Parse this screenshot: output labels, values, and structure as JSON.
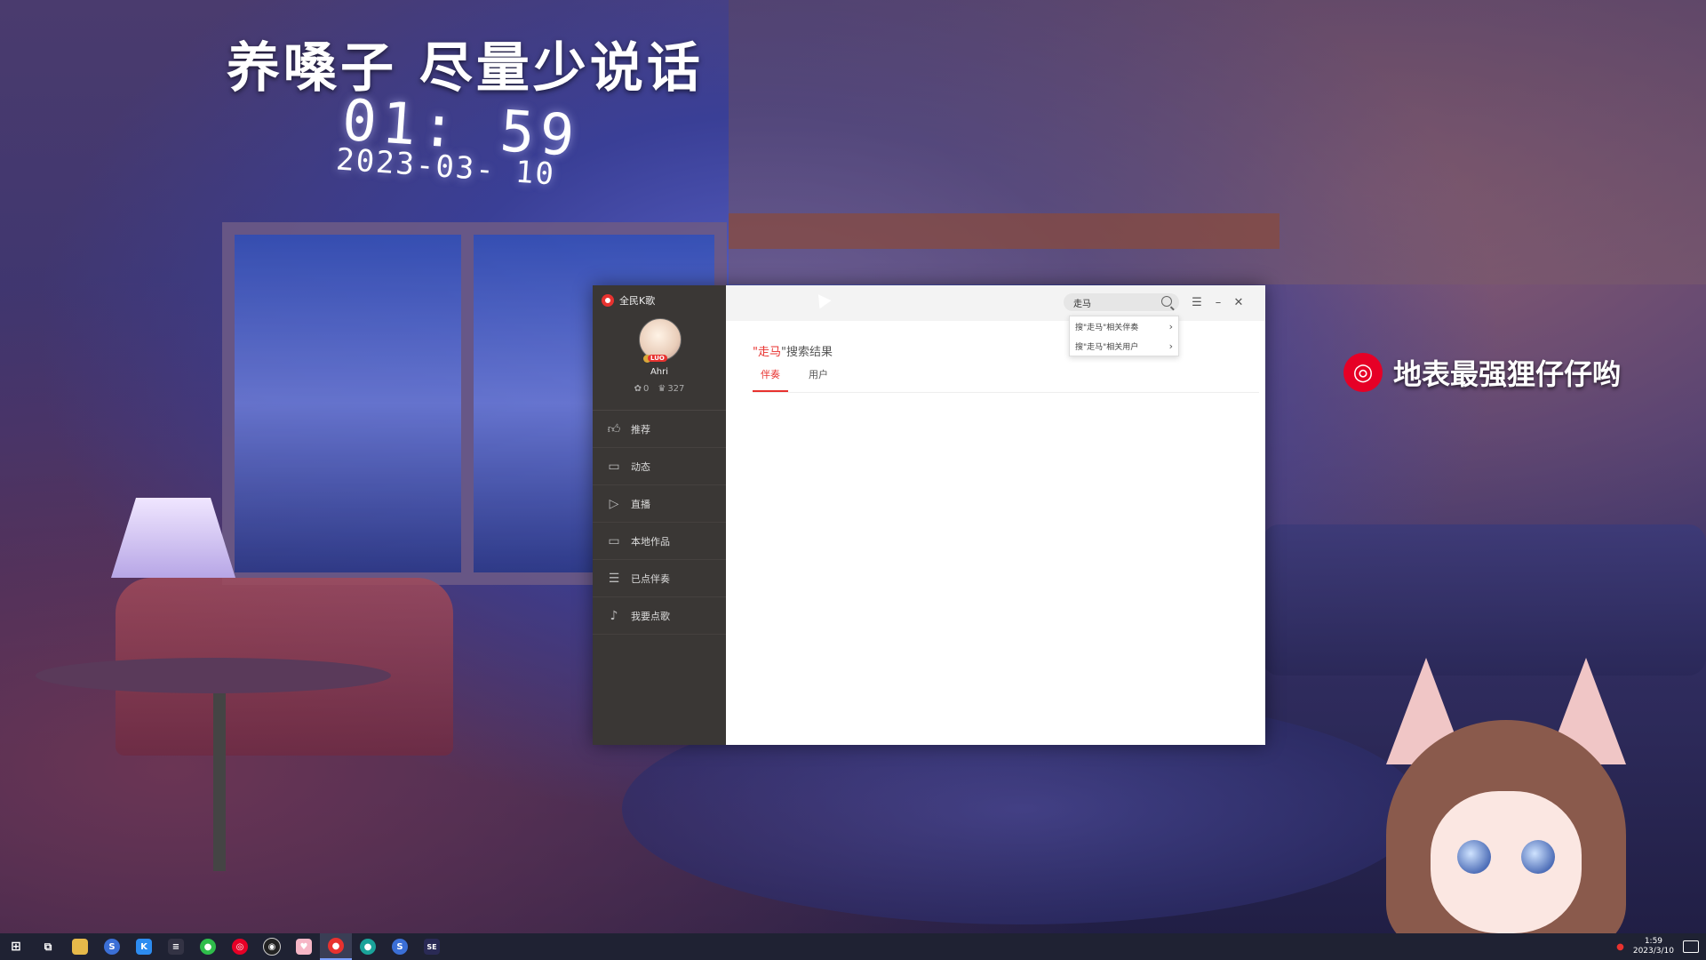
{
  "overlay": {
    "slogan": "养嗓子 尽量少说话",
    "clock_time": "01: 59",
    "clock_date": "2023-03- 10",
    "streamer_name": "地表最强狸仔仔哟",
    "streamer_logo_icon": "netease-music-icon"
  },
  "app": {
    "name": "全民K歌",
    "user": {
      "name": "Ahri",
      "level_badge": "LUO",
      "flowers": "0",
      "fans": "327"
    },
    "nav": [
      {
        "label": "推荐",
        "icon": "thumbs-up-icon"
      },
      {
        "label": "动态",
        "icon": "chat-icon"
      },
      {
        "label": "直播",
        "icon": "live-video-icon"
      },
      {
        "label": "本地作品",
        "icon": "monitor-icon"
      },
      {
        "label": "已点伴奏",
        "icon": "playlist-icon"
      },
      {
        "label": "我要点歌",
        "icon": "mic-icon"
      }
    ],
    "search": {
      "value": "走马",
      "suggestions": [
        "搜\"走马\"相关伴奏",
        "搜\"走马\"相关用户"
      ]
    },
    "result": {
      "prefix": "\"",
      "keyword": "走马",
      "suffix": "\"搜索结果"
    },
    "tabs": [
      "伴奏",
      "用户"
    ],
    "active_tab": "伴奏",
    "accent_color": "#e8322f"
  },
  "taskbar": {
    "clock_time": "1:59",
    "clock_date": "2023/3/10"
  }
}
